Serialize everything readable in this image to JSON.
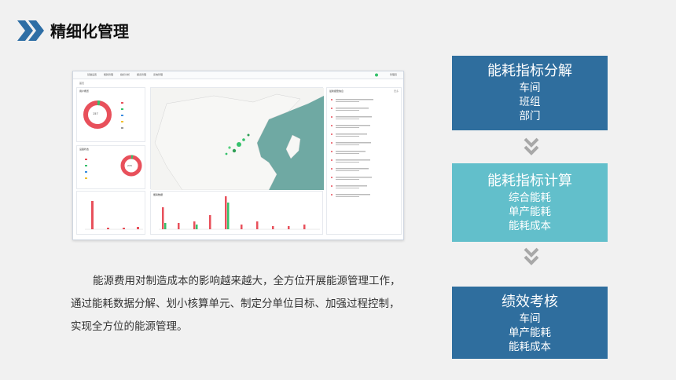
{
  "header": {
    "icon": "double-chevron-right-icon",
    "title": "精细化管理"
  },
  "screenshot": {
    "nav": [
      "基础设置",
      "能耗管理",
      "指标分析",
      "报表管理",
      "系统管理"
    ],
    "crumb": "首页",
    "user_label": "管理员",
    "left_card1_title": "用户概览",
    "left_card1_value": "157",
    "left_card2_title": "设备状态",
    "left_card2_value": "270",
    "bottom_card_title": "能耗数据",
    "right_card_title": "最新报警信息",
    "right_card_tag": "更多",
    "filter_colors": [
      "#e8505b",
      "#35c16b",
      "#3b8de0",
      "#d05bd6",
      "#f0c030"
    ],
    "alarm_count": 12
  },
  "description": "能源费用对制造成本的影响越来越大，全方位开展能源管理工作，通过能耗数据分解、划小核算单元、制定分单位目标、加强过程控制，实现全方位的能源管理。",
  "flow": {
    "boxes": [
      {
        "title": "能耗指标分解",
        "items": [
          "车间",
          "班组",
          "部门"
        ]
      },
      {
        "title": "能耗指标计算",
        "items": [
          "综合能耗",
          "单产能耗",
          "能耗成本"
        ]
      },
      {
        "title": "绩效考核",
        "items": [
          "车间",
          "单产能耗",
          "能耗成本"
        ]
      }
    ],
    "arrow_icon": "double-chevron-down-icon"
  },
  "colors": {
    "dark_blue": "#2f6e9e",
    "teal": "#62bfcb",
    "accent_red": "#e8505b",
    "map_sea": "#6fa9a3"
  }
}
